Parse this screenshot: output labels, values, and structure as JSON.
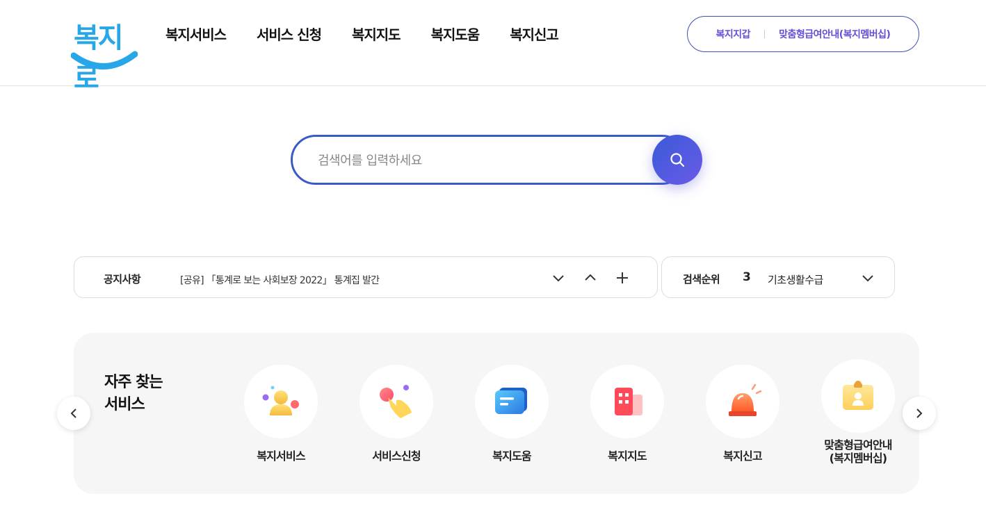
{
  "logo": {
    "text": "복지로",
    "color": "#27a7e8"
  },
  "nav": {
    "items": [
      "복지서비스",
      "서비스 신청",
      "복지지도",
      "복지도움",
      "복지신고"
    ]
  },
  "util": {
    "wallet": "복지지갑",
    "membership": "맞춤형급여안내(복지멤버십)"
  },
  "search": {
    "placeholder": "검색어를 입력하세요",
    "button_icon": "search-icon"
  },
  "notice": {
    "label": "공지사항",
    "text": "[공유] 「통계로 보는 사회보장 2022」 통계집 발간",
    "controls": [
      "chevron-down-icon",
      "chevron-up-icon",
      "plus-icon"
    ]
  },
  "rank": {
    "label": "검색순위",
    "number": "3",
    "keyword": "기초생활수급",
    "control": "chevron-down-icon"
  },
  "frequent": {
    "title_line1": "자주 찾는",
    "title_line2": "서비스",
    "items": [
      {
        "label": "복지서비스",
        "icon": "person-service-icon"
      },
      {
        "label": "서비스신청",
        "icon": "hand-tap-icon"
      },
      {
        "label": "복지도움",
        "icon": "message-card-icon"
      },
      {
        "label": "복지지도",
        "icon": "building-icon"
      },
      {
        "label": "복지신고",
        "icon": "siren-icon"
      },
      {
        "label_line1": "맞춤형급여안내",
        "label_line2": "(복지멤버십)",
        "icon": "membership-card-icon"
      }
    ],
    "prev_icon": "chevron-left-icon",
    "next_icon": "chevron-right-icon"
  },
  "colors": {
    "primary": "#3a5ac8",
    "accent": "#6450d8",
    "panel": "#f6f6f6"
  }
}
